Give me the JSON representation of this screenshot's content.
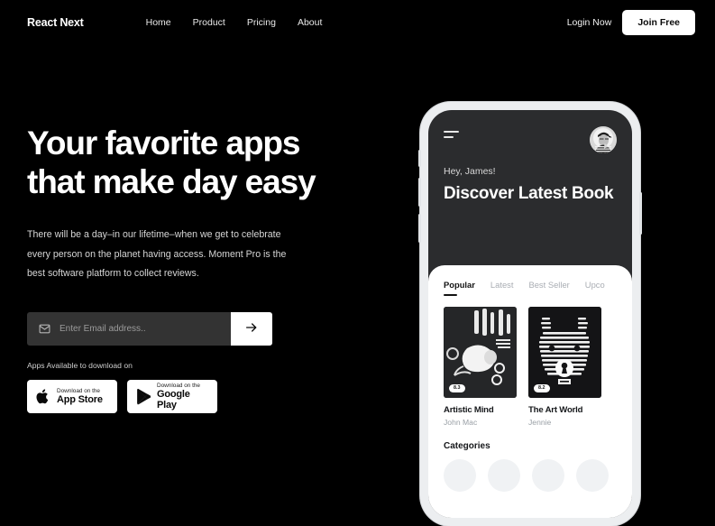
{
  "nav": {
    "logo": "React Next",
    "links": [
      {
        "label": "Home"
      },
      {
        "label": "Product"
      },
      {
        "label": "Pricing"
      },
      {
        "label": "About"
      }
    ],
    "login_label": "Login Now",
    "join_label": "Join Free"
  },
  "hero": {
    "heading_line1": "Your favorite apps",
    "heading_line2": "that make day easy",
    "paragraph": "There will be a day–in our lifetime–when we get to celebrate every person on the planet having access. Moment Pro is the best software platform to collect reviews.",
    "email_placeholder": "Enter Email address..",
    "email_value": "",
    "submit_icon": "arrow-right-icon",
    "mail_icon": "mail-icon",
    "apps_label": "Apps Available to download on",
    "stores": [
      {
        "icon": "apple-icon",
        "small": "Download on the",
        "big": "App Store"
      },
      {
        "icon": "google-play-icon",
        "small": "Download on the",
        "big": "Google Play"
      }
    ]
  },
  "phone": {
    "menu_icon": "hamburger-menu-icon",
    "avatar_icon": "user-avatar",
    "greeting": "Hey, James!",
    "title": "Discover Latest Book",
    "tabs": [
      {
        "label": "Popular",
        "active": true
      },
      {
        "label": "Latest",
        "active": false
      },
      {
        "label": "Best Seller",
        "active": false
      },
      {
        "label": "Upco",
        "active": false
      }
    ],
    "books": [
      {
        "title": "Artistic Mind",
        "author": "John Mac",
        "rating": "8.3",
        "cover": "abstract-white-shapes"
      },
      {
        "title": "The Art World",
        "author": "Jennie",
        "rating": "8.2",
        "cover": "striped-bear-keyhole"
      }
    ],
    "categories_heading": "Categories",
    "category_count": 4
  },
  "colors": {
    "background": "#000000",
    "accent": "#ffffff",
    "phone_frame": "#eceef0",
    "phone_header": "#2b2c2e",
    "input_bg": "#333333",
    "muted_text": "#9aa0a6"
  }
}
